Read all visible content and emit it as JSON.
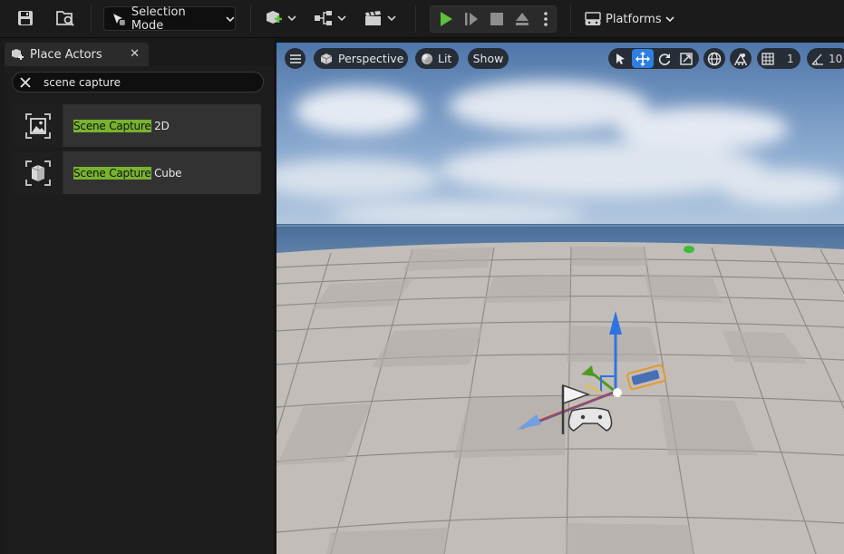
{
  "toolbar": {
    "selection_mode_label": "Selection Mode",
    "platforms_label": "Platforms",
    "icons": [
      "save-icon",
      "content-browser-icon",
      "add-actor-icon",
      "blueprint-icon",
      "cinematics-icon",
      "play-icon",
      "advance-frame-icon",
      "stop-icon",
      "eject-icon",
      "more-options-icon",
      "platforms-icon"
    ],
    "play_color": "#5cc13b"
  },
  "place_actors": {
    "tab_title": "Place Actors",
    "close_glyph": "✕",
    "search": {
      "value": "scene capture",
      "placeholder": ""
    },
    "results": [
      {
        "highlight": "Scene Capture",
        "rest": " 2D",
        "icon": "scene-capture-2d-icon"
      },
      {
        "highlight": "Scene Capture",
        "rest": " Cube",
        "icon": "scene-capture-cube-icon"
      }
    ],
    "highlight_color": "#78b330"
  },
  "viewport": {
    "perspective_label": "Perspective",
    "lit_label": "Lit",
    "show_label": "Show",
    "grid_snap_value": "1",
    "rotation_snap_value": "10",
    "active_tool_color": "#2f7fe0"
  }
}
